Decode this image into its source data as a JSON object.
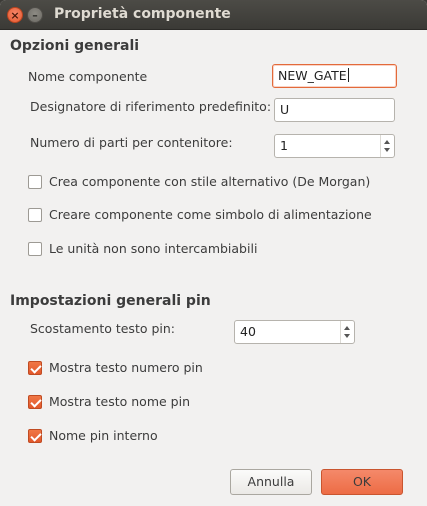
{
  "window": {
    "title": "Proprietà componente"
  },
  "general": {
    "title": "Opzioni generali",
    "name_label": "Nome componente",
    "name_value": "NEW_GATE",
    "designator_label": "Designatore di riferimento predefinito:",
    "designator_value": "U",
    "parts_label": "Numero di parti per contenitore:",
    "parts_value": "1",
    "checkboxes": [
      {
        "label": "Crea componente con stile alternativo (De Morgan)",
        "checked": false
      },
      {
        "label": "Creare componente come simbolo di alimentazione",
        "checked": false
      },
      {
        "label": "Le unità non sono intercambiabili",
        "checked": false
      }
    ]
  },
  "pins": {
    "title": "Impostazioni generali pin",
    "offset_label": "Scostamento testo pin:",
    "offset_value": "40",
    "checkboxes": [
      {
        "label": "Mostra testo numero pin",
        "checked": true
      },
      {
        "label": "Mostra testo nome pin",
        "checked": true
      },
      {
        "label": "Nome pin interno",
        "checked": true
      }
    ]
  },
  "buttons": {
    "cancel": "Annulla",
    "ok": "OK"
  },
  "colors": {
    "accent": "#e95420",
    "titlebar": "#3c3b37",
    "background": "#f2f1f0"
  }
}
